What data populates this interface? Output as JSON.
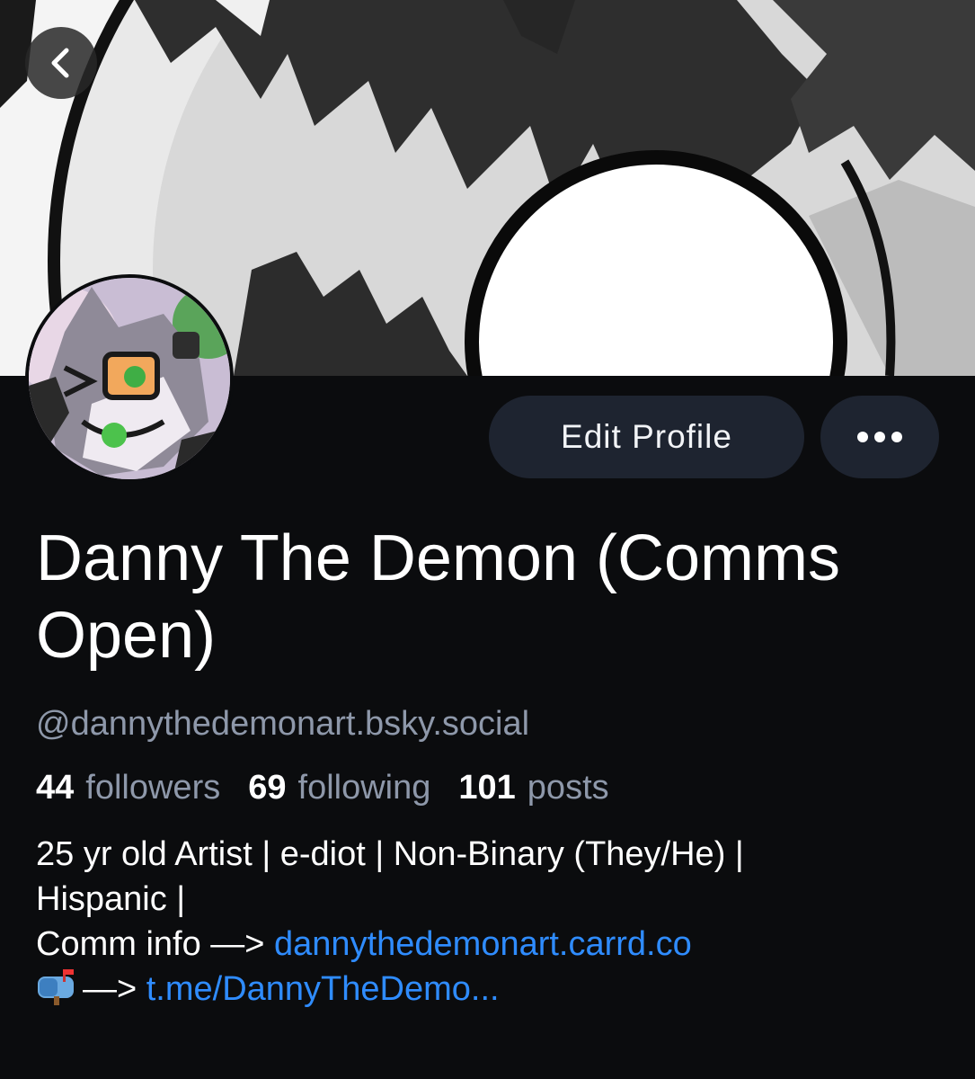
{
  "banner": {
    "colors": {
      "dark": "#2b2b2b",
      "light": "#f2f2f2",
      "mid": "#bdbdbd"
    }
  },
  "nav": {
    "back_icon": "chevron-left-icon"
  },
  "actions": {
    "edit_profile_label": "Edit Profile",
    "more_icon": "ellipsis-icon"
  },
  "profile": {
    "display_name": "Danny The Demon (Comms Open)",
    "handle": "@dannythedemonart.bsky.social",
    "stats": [
      {
        "value": "44",
        "label": "followers"
      },
      {
        "value": "69",
        "label": "following"
      },
      {
        "value": "101",
        "label": "posts"
      }
    ],
    "bio": {
      "line1": "25 yr old Artist | e-diot | Non-Binary (They/He) |",
      "line2": "Hispanic |",
      "line3_prefix": "Comm info —> ",
      "line3_link": "dannythedemonart.carrd.co",
      "line4_icon": "mailbox-icon",
      "line4_prefix": "—> ",
      "line4_link": "t.me/DannyTheDemo..."
    }
  },
  "colors": {
    "background": "#0b0c0e",
    "button_bg": "#1e2430",
    "muted_text": "#8e98aa",
    "link": "#2f8cff"
  }
}
